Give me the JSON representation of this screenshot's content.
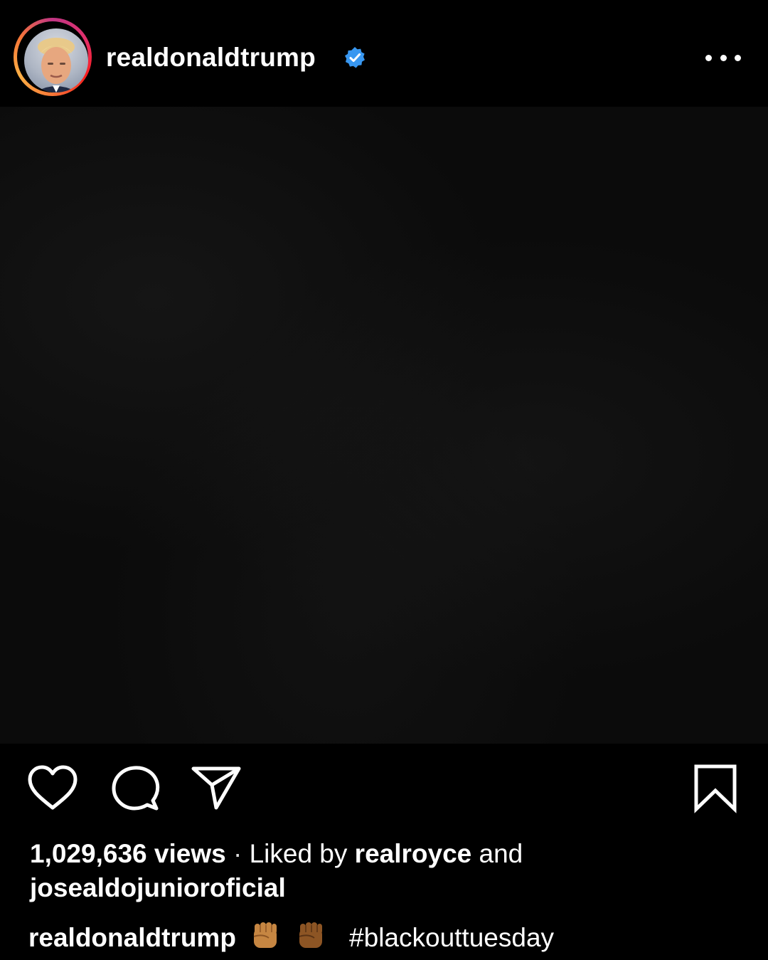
{
  "post": {
    "username": "realdonaldtrump",
    "views_count": "1,029,636",
    "views_label": "views",
    "separator": "·",
    "liked_by_prefix": "Liked by",
    "liked_by_user": "realroyce",
    "liked_by_and": "and",
    "liked_by_other": "josealdojunioroficial",
    "caption_username": "realdonaldtrump",
    "caption_emojis": [
      "raised-fist-medium-skin-tone",
      "raised-fist-medium-dark-skin-tone"
    ],
    "caption_hashtag": "#blackouttuesday"
  },
  "icons": {
    "verified": "verified-badge-icon",
    "more": "more-options-icon",
    "like": "heart-icon",
    "comment": "comment-bubble-icon",
    "share": "paper-plane-icon",
    "save": "bookmark-icon"
  },
  "colors": {
    "background": "#000000",
    "verified_blue": "#3897f0",
    "text": "#ffffff"
  }
}
